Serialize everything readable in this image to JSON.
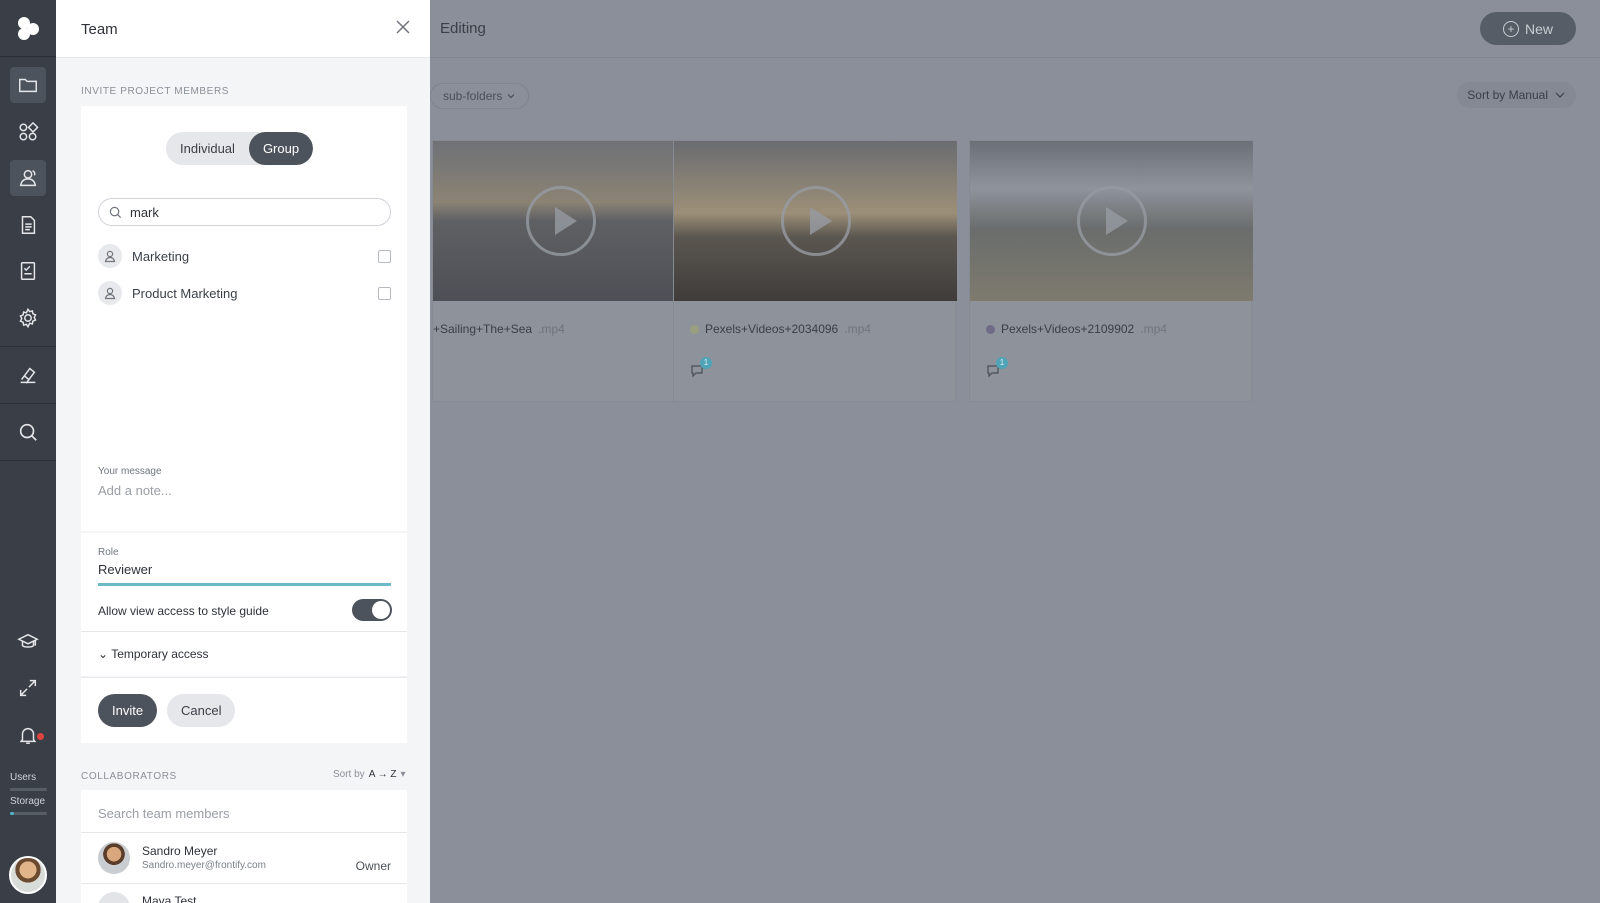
{
  "background": {
    "breadcrumb": "Editing",
    "new_button": "New",
    "subfolders_label": "sub-folders",
    "sort_label": "Sort by Manual",
    "cards": [
      {
        "name": "+Sailing+The+Sea",
        "ext": ".mp4",
        "dot_color": "",
        "comments": ""
      },
      {
        "name": "Pexels+Videos+2034096",
        "ext": ".mp4",
        "dot_color": "#9aa07f",
        "comments": "1"
      },
      {
        "name": "Pexels+Videos+2109902",
        "ext": ".mp4",
        "dot_color": "#6f6b86",
        "comments": "1"
      }
    ]
  },
  "rail": {
    "users_label": "Users",
    "storage_label": "Storage"
  },
  "panel": {
    "title": "Team",
    "invite_label": "INVITE PROJECT MEMBERS",
    "tabs": [
      {
        "label": "Individual",
        "active": false
      },
      {
        "label": "Group",
        "active": true
      }
    ],
    "search_value": "mark",
    "groups": [
      {
        "name": "Marketing"
      },
      {
        "name": "Product Marketing"
      }
    ],
    "message_label": "Your message",
    "message_placeholder": "Add a note...",
    "role_label": "Role",
    "role_value": "Reviewer",
    "style_guide_label": "Allow view access to style guide",
    "temporary_label": "Temporary access",
    "invite_button": "Invite",
    "cancel_button": "Cancel",
    "collaborators_label": "COLLABORATORS",
    "sort_prefix": "Sort by",
    "sort_value": "A → Z",
    "member_search_placeholder": "Search team members",
    "members": [
      {
        "name": "Sandro Meyer",
        "email": "Sandro.meyer@frontify.com",
        "role": "Owner"
      },
      {
        "name": "Maya Test",
        "email": "",
        "role": ""
      }
    ]
  }
}
